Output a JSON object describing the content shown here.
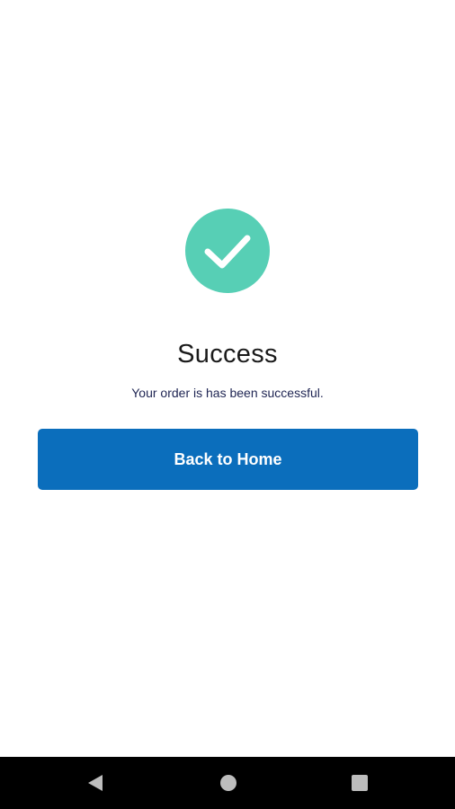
{
  "success": {
    "icon": "check-circle-icon",
    "title": "Success",
    "message": "Your order is has been successful.",
    "button_label": "Back to Home"
  },
  "navbar": {
    "back_icon": "back-triangle-icon",
    "home_icon": "home-circle-icon",
    "recents_icon": "recents-square-icon"
  },
  "colors": {
    "accent_green": "#57cfb5",
    "button_blue": "#0b6ebc",
    "title_text": "#1a1a1a",
    "message_text": "#1e2452",
    "navbar_bg": "#000000",
    "nav_icon": "#bdbdbd"
  }
}
